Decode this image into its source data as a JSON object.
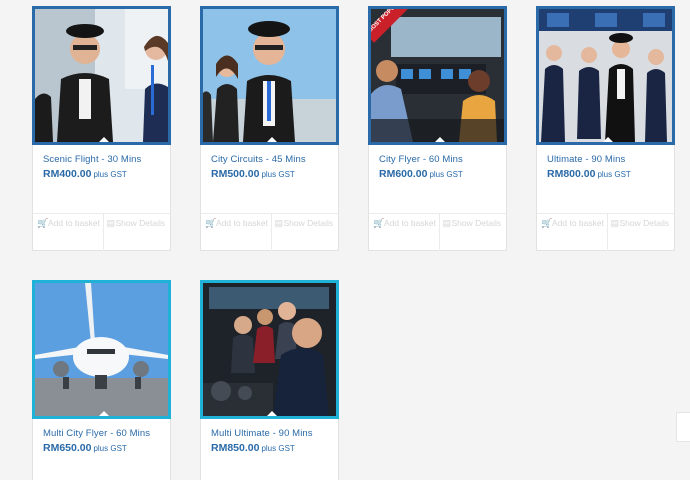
{
  "products": [
    {
      "title": "Scenic Flight - 30 Mins",
      "price": "RM400.00",
      "tax": "plus GST",
      "add": "Add to basket",
      "show": "Show Details"
    },
    {
      "title": "City Circuits - 45 Mins",
      "price": "RM500.00",
      "tax": "plus GST",
      "add": "Add to basket",
      "show": "Show Details"
    },
    {
      "title": "City Flyer - 60 Mins",
      "price": "RM600.00",
      "tax": "plus GST",
      "add": "Add to basket",
      "show": "Show Details",
      "badge": "MOST POPULAR"
    },
    {
      "title": "Ultimate - 90 Mins",
      "price": "RM800.00",
      "tax": "plus GST",
      "add": "Add to basket",
      "show": "Show Details"
    },
    {
      "title": "Multi City Flyer - 60 Mins",
      "price": "RM650.00",
      "tax": "plus GST"
    },
    {
      "title": "Multi Ultimate - 90 Mins",
      "price": "RM850.00",
      "tax": "plus GST"
    }
  ],
  "colors": {
    "accent": "#2a6aa8",
    "highlight": "#20b2d6",
    "badge": "#c9202a"
  },
  "icons": {
    "add": "cart-icon",
    "show": "document-icon"
  }
}
